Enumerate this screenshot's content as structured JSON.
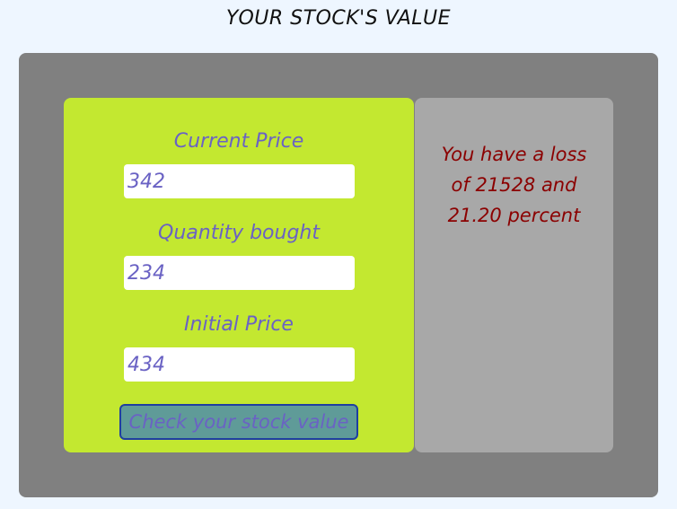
{
  "header": {
    "title": "YOUR STOCK'S VALUE"
  },
  "form": {
    "current_price": {
      "label": "Current Price",
      "value": "342"
    },
    "quantity": {
      "label": "Quantity bought",
      "value": "234"
    },
    "initial_price": {
      "label": "Initial Price",
      "value": "434"
    },
    "check_button_label": "Check your stock value"
  },
  "result": {
    "message": "You have a loss of 21528 and 21.20 percent"
  },
  "colors": {
    "page_background": "#eef6ff",
    "outer_panel": "#808080",
    "form_panel": "#c3e830",
    "result_panel": "#a8a8a8",
    "label_text": "#6a62c4",
    "result_text": "#8b0000",
    "button_background": "#5f9b98",
    "button_border": "#1f3fa0"
  }
}
